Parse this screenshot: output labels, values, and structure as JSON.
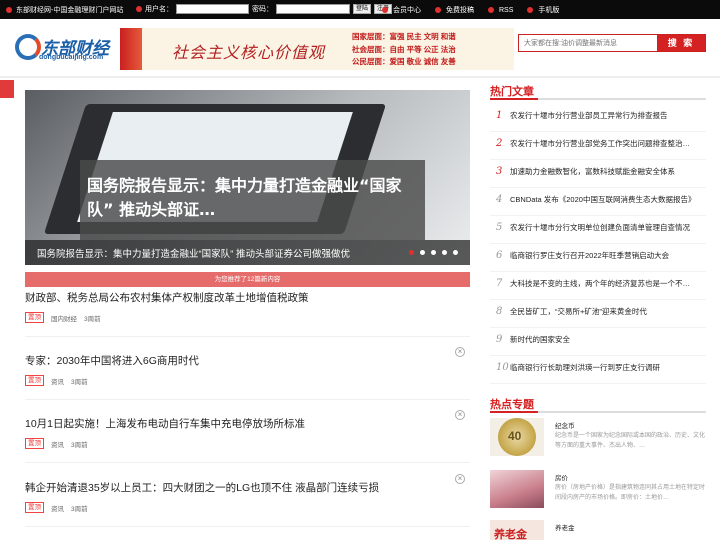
{
  "topbar": {
    "site_name": "东部财经网-中国金融理财门户网站",
    "username_label": "用户名：",
    "password_label": "密码：",
    "login_btn": "登陆",
    "register_btn": "注册",
    "links": [
      "会员中心",
      "免费投稿",
      "RSS",
      "手机版"
    ]
  },
  "logo": {
    "name": "东部财经",
    "url": "dongbucaijing.com"
  },
  "banner": {
    "slogan": "社会主义核心价值观",
    "values": [
      "国家层面：富强 民主 文明 和谐",
      "社会层面：自由 平等 公正 法治",
      "公民层面：爱国 敬业 诚信 友善"
    ]
  },
  "search": {
    "placeholder": "大家都在搜:油价调整最新消息",
    "button": "搜 索"
  },
  "slider": {
    "headline": "国务院报告显示：集中力量打造金融业“国家队” 推动头部证…",
    "caption": "国务院报告显示：集中力量打造金融业“国家队” 推动头部证券公司做强做优"
  },
  "notice": "为您推荐了12篇新内容",
  "news": [
    {
      "title": "财政部、税务总局公布农村集体产权制度改革土地增值税政策",
      "tag": "置顶",
      "category": "国内财经",
      "time": "3周前"
    },
    {
      "title": "专家：2030年中国将进入6G商用时代",
      "tag": "置顶",
      "category": "资讯",
      "time": "3周前"
    },
    {
      "title": "10月1日起实施！上海发布电动自行车集中充电停放场所标准",
      "tag": "置顶",
      "category": "资讯",
      "time": "3周前"
    },
    {
      "title": "韩企开始清退35岁以上员工：四大财团之一的LG也顶不住 液晶部门连续亏损",
      "tag": "置顶",
      "category": "资讯",
      "time": "3周前"
    }
  ],
  "hot": {
    "title": "热门文章",
    "items": [
      {
        "num": "1",
        "text": "农发行十堰市分行营业部员工异常行为排查报告"
      },
      {
        "num": "2",
        "text": "农发行十堰市分行营业部党务工作突出问题排查整治…"
      },
      {
        "num": "3",
        "text": "加速助力金融数智化，富数科技赋能金融安全体系"
      },
      {
        "num": "4",
        "text": "CBNData 发布《2020中国互联网消费生态大数据报告》"
      },
      {
        "num": "5",
        "text": "农发行十堰市分行文明单位创建负面清单管理自查情况"
      },
      {
        "num": "6",
        "text": "临商银行罗庄支行召开2022年旺季营销启动大会"
      },
      {
        "num": "7",
        "text": "大科技是不变的主线，两个年的经济复苏也是一个不…"
      },
      {
        "num": "8",
        "text": "全民皆矿工，“交易所+矿池”迎来黄金时代"
      },
      {
        "num": "9",
        "text": "新时代的国家安全"
      },
      {
        "num": "10",
        "text": "临商银行行长助理刘洪瑛一行到罗庄支行调研"
      }
    ]
  },
  "topics": {
    "title": "热点专题",
    "items": [
      {
        "name": "纪念币",
        "desc": "纪念币是一个国家为纪念国际或本国的政治、历史、文化等方面的重大事件、杰出人物、…",
        "thumb_text": "40"
      },
      {
        "name": "房价",
        "desc": "房价（房地产价格）是指建筑物连同其占用土地在特定时间段内房产的市场价格。即房价：土地价…",
        "thumb_text": ""
      },
      {
        "name": "养老金",
        "desc": "",
        "thumb_text": "养老金"
      }
    ]
  }
}
